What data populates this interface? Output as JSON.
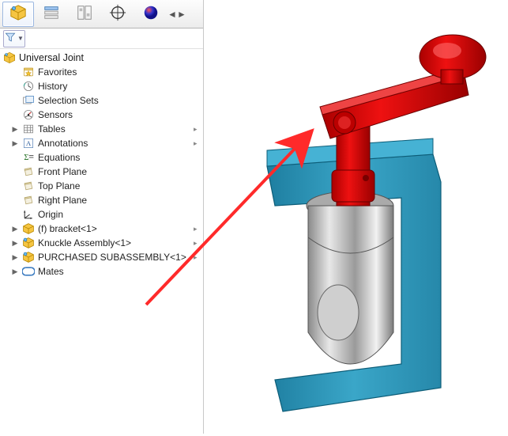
{
  "tabs": [
    {
      "name": "feature-manager",
      "active": true
    },
    {
      "name": "property-manager",
      "active": false
    },
    {
      "name": "configuration-manager",
      "active": false
    },
    {
      "name": "dimxpert",
      "active": false
    },
    {
      "name": "appearance",
      "active": false
    }
  ],
  "root": {
    "label": "Universal Joint"
  },
  "tree": [
    {
      "icon": "favorites",
      "label": "Favorites",
      "expandable": false
    },
    {
      "icon": "history",
      "label": "History",
      "expandable": false
    },
    {
      "icon": "selectionsets",
      "label": "Selection Sets",
      "expandable": false
    },
    {
      "icon": "sensors",
      "label": "Sensors",
      "expandable": false
    },
    {
      "icon": "tables",
      "label": "Tables",
      "expandable": true,
      "caret": true
    },
    {
      "icon": "annotations",
      "label": "Annotations",
      "expandable": true,
      "caret": true
    },
    {
      "icon": "equations",
      "label": "Equations",
      "expandable": false
    },
    {
      "icon": "plane",
      "label": "Front Plane",
      "expandable": false
    },
    {
      "icon": "plane",
      "label": "Top Plane",
      "expandable": false
    },
    {
      "icon": "plane",
      "label": "Right Plane",
      "expandable": false
    },
    {
      "icon": "origin",
      "label": "Origin",
      "expandable": false
    },
    {
      "icon": "part",
      "label": "(f) bracket<1>",
      "expandable": true,
      "caret": true
    },
    {
      "icon": "subasm",
      "label": "Knuckle Assembly<1>",
      "expandable": true,
      "caret": true
    },
    {
      "icon": "subasm",
      "label": "PURCHASED SUBASSEMBLY<1>",
      "expandable": true,
      "caret": true
    },
    {
      "icon": "mates",
      "label": "Mates",
      "expandable": true
    }
  ]
}
